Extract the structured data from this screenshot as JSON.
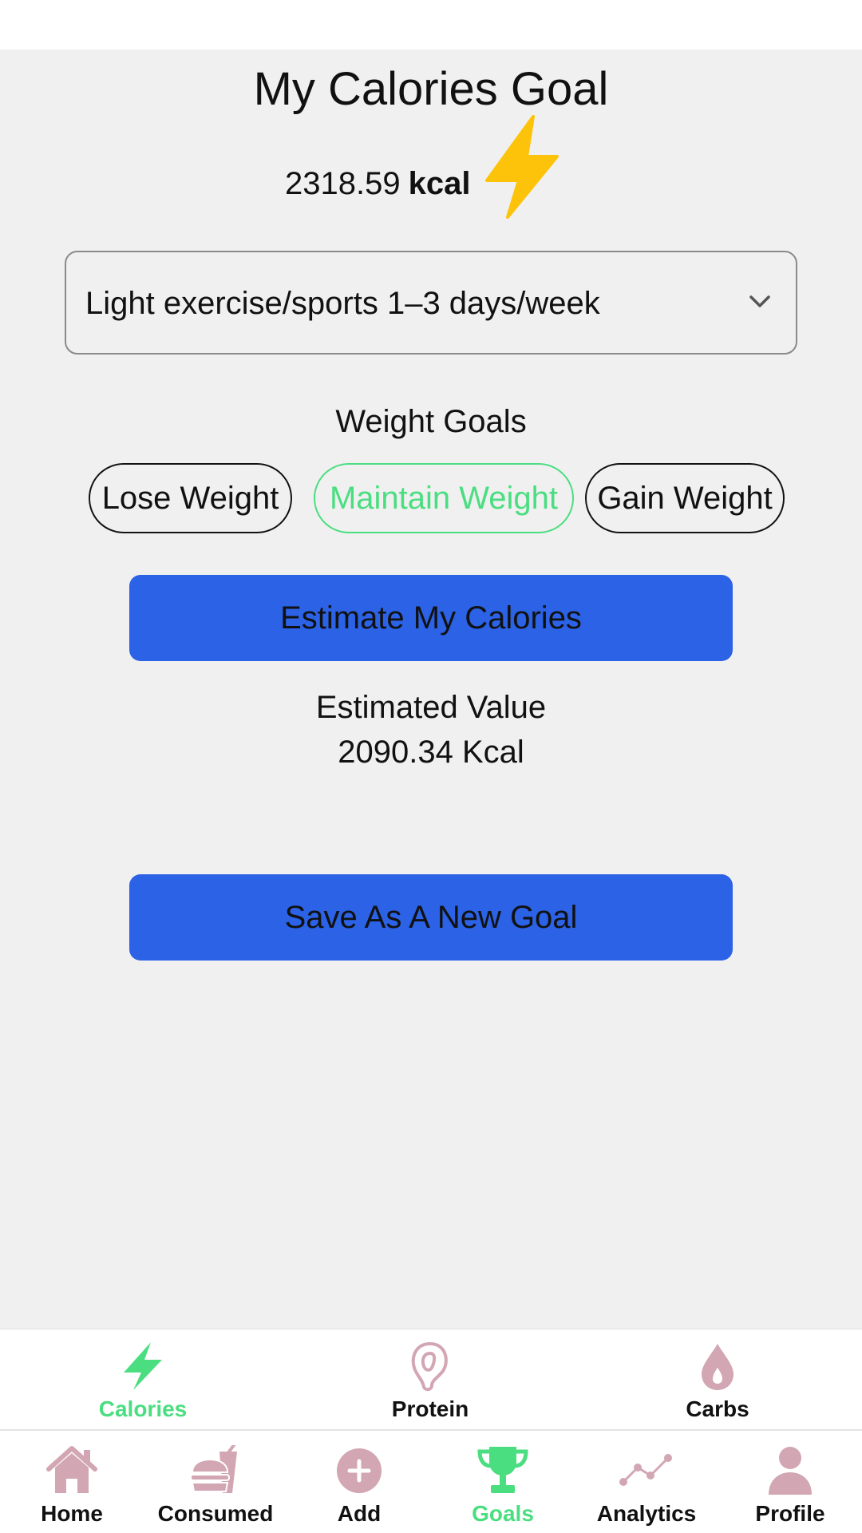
{
  "colors": {
    "accent_green": "#4ade80",
    "button_blue": "#2b62e6",
    "icon_pink": "#d2a6b3",
    "bolt_yellow": "#fdc30a"
  },
  "header": {
    "title": "My Calories Goal",
    "kcal_value": "2318.59",
    "kcal_unit": "kcal",
    "icon": "lightning-bolt-icon"
  },
  "activity_select": {
    "value": "Light exercise/sports 1–3 days/week"
  },
  "weight_goals": {
    "label": "Weight Goals",
    "options": [
      {
        "label": "Lose Weight",
        "selected": false
      },
      {
        "label": "Maintain Weight",
        "selected": true
      },
      {
        "label": "Gain Weight",
        "selected": false
      }
    ]
  },
  "estimate": {
    "button_label": "Estimate My Calories",
    "result_label": "Estimated Value",
    "result_value": "2090.34 Kcal"
  },
  "save": {
    "button_label": "Save As A New Goal"
  },
  "macro_tabs": [
    {
      "label": "Calories",
      "icon": "lightning-bolt-icon",
      "active": true
    },
    {
      "label": "Protein",
      "icon": "meat-icon",
      "active": false
    },
    {
      "label": "Carbs",
      "icon": "drop-icon",
      "active": false
    }
  ],
  "bottom_nav": [
    {
      "label": "Home",
      "icon": "home-icon",
      "active": false
    },
    {
      "label": "Consumed",
      "icon": "fast-food-icon",
      "active": false
    },
    {
      "label": "Add",
      "icon": "add-circle-icon",
      "active": false
    },
    {
      "label": "Goals",
      "icon": "trophy-icon",
      "active": true
    },
    {
      "label": "Analytics",
      "icon": "chart-line-icon",
      "active": false
    },
    {
      "label": "Profile",
      "icon": "person-icon",
      "active": false
    }
  ]
}
